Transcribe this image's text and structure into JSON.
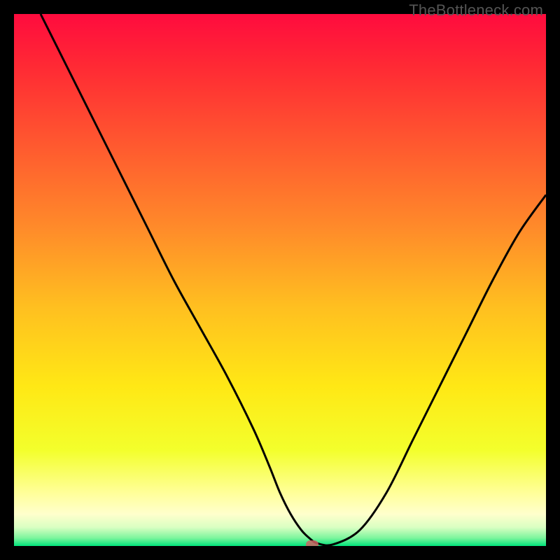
{
  "watermark": "TheBottleneck.com",
  "chart_data": {
    "type": "line",
    "title": "",
    "xlabel": "",
    "ylabel": "",
    "xlim": [
      0,
      100
    ],
    "ylim": [
      0,
      100
    ],
    "grid": false,
    "legend": false,
    "gradient_stops": [
      {
        "offset": 0.0,
        "color": "#ff0b3e"
      },
      {
        "offset": 0.1,
        "color": "#ff2a34"
      },
      {
        "offset": 0.25,
        "color": "#ff5a2f"
      },
      {
        "offset": 0.4,
        "color": "#ff8a2a"
      },
      {
        "offset": 0.55,
        "color": "#ffbf20"
      },
      {
        "offset": 0.7,
        "color": "#ffe815"
      },
      {
        "offset": 0.82,
        "color": "#f3ff2c"
      },
      {
        "offset": 0.9,
        "color": "#ffff99"
      },
      {
        "offset": 0.94,
        "color": "#ffffcc"
      },
      {
        "offset": 0.965,
        "color": "#d9ffc2"
      },
      {
        "offset": 0.985,
        "color": "#7cf59d"
      },
      {
        "offset": 1.0,
        "color": "#00e37a"
      }
    ],
    "series": [
      {
        "name": "curve",
        "color": "#000000",
        "width": 3,
        "x": [
          5,
          10,
          15,
          20,
          25,
          30,
          35,
          40,
          45,
          48,
          50,
          52,
          54,
          55.5,
          57,
          60,
          65,
          70,
          75,
          80,
          85,
          90,
          95,
          100
        ],
        "y": [
          100,
          90,
          80,
          70,
          60,
          50,
          41,
          32,
          22,
          15,
          10,
          6,
          3,
          1.5,
          0.5,
          0.3,
          3,
          10,
          20,
          30,
          40,
          50,
          59,
          66
        ]
      }
    ],
    "flat_bottom": {
      "x_start": 53,
      "x_end": 58,
      "y": 0.3
    },
    "marker": {
      "x": 56,
      "y": 0.3,
      "color": "#ce6161"
    }
  }
}
